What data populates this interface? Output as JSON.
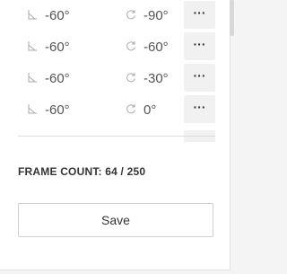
{
  "rows": [
    {
      "angle": "-60°",
      "rotation": "-90°",
      "more_label": "···"
    },
    {
      "angle": "-60°",
      "rotation": "-60°",
      "more_label": "···"
    },
    {
      "angle": "-60°",
      "rotation": "-30°",
      "more_label": "···"
    },
    {
      "angle": "-60°",
      "rotation": "0°",
      "more_label": "···"
    }
  ],
  "frame_count": {
    "text": "FRAME COUNT: 64 / 250"
  },
  "save_label": "Save",
  "icons": {
    "angle": "angle-icon",
    "rotation": "rotate-icon",
    "more": "more-dots-icon"
  }
}
